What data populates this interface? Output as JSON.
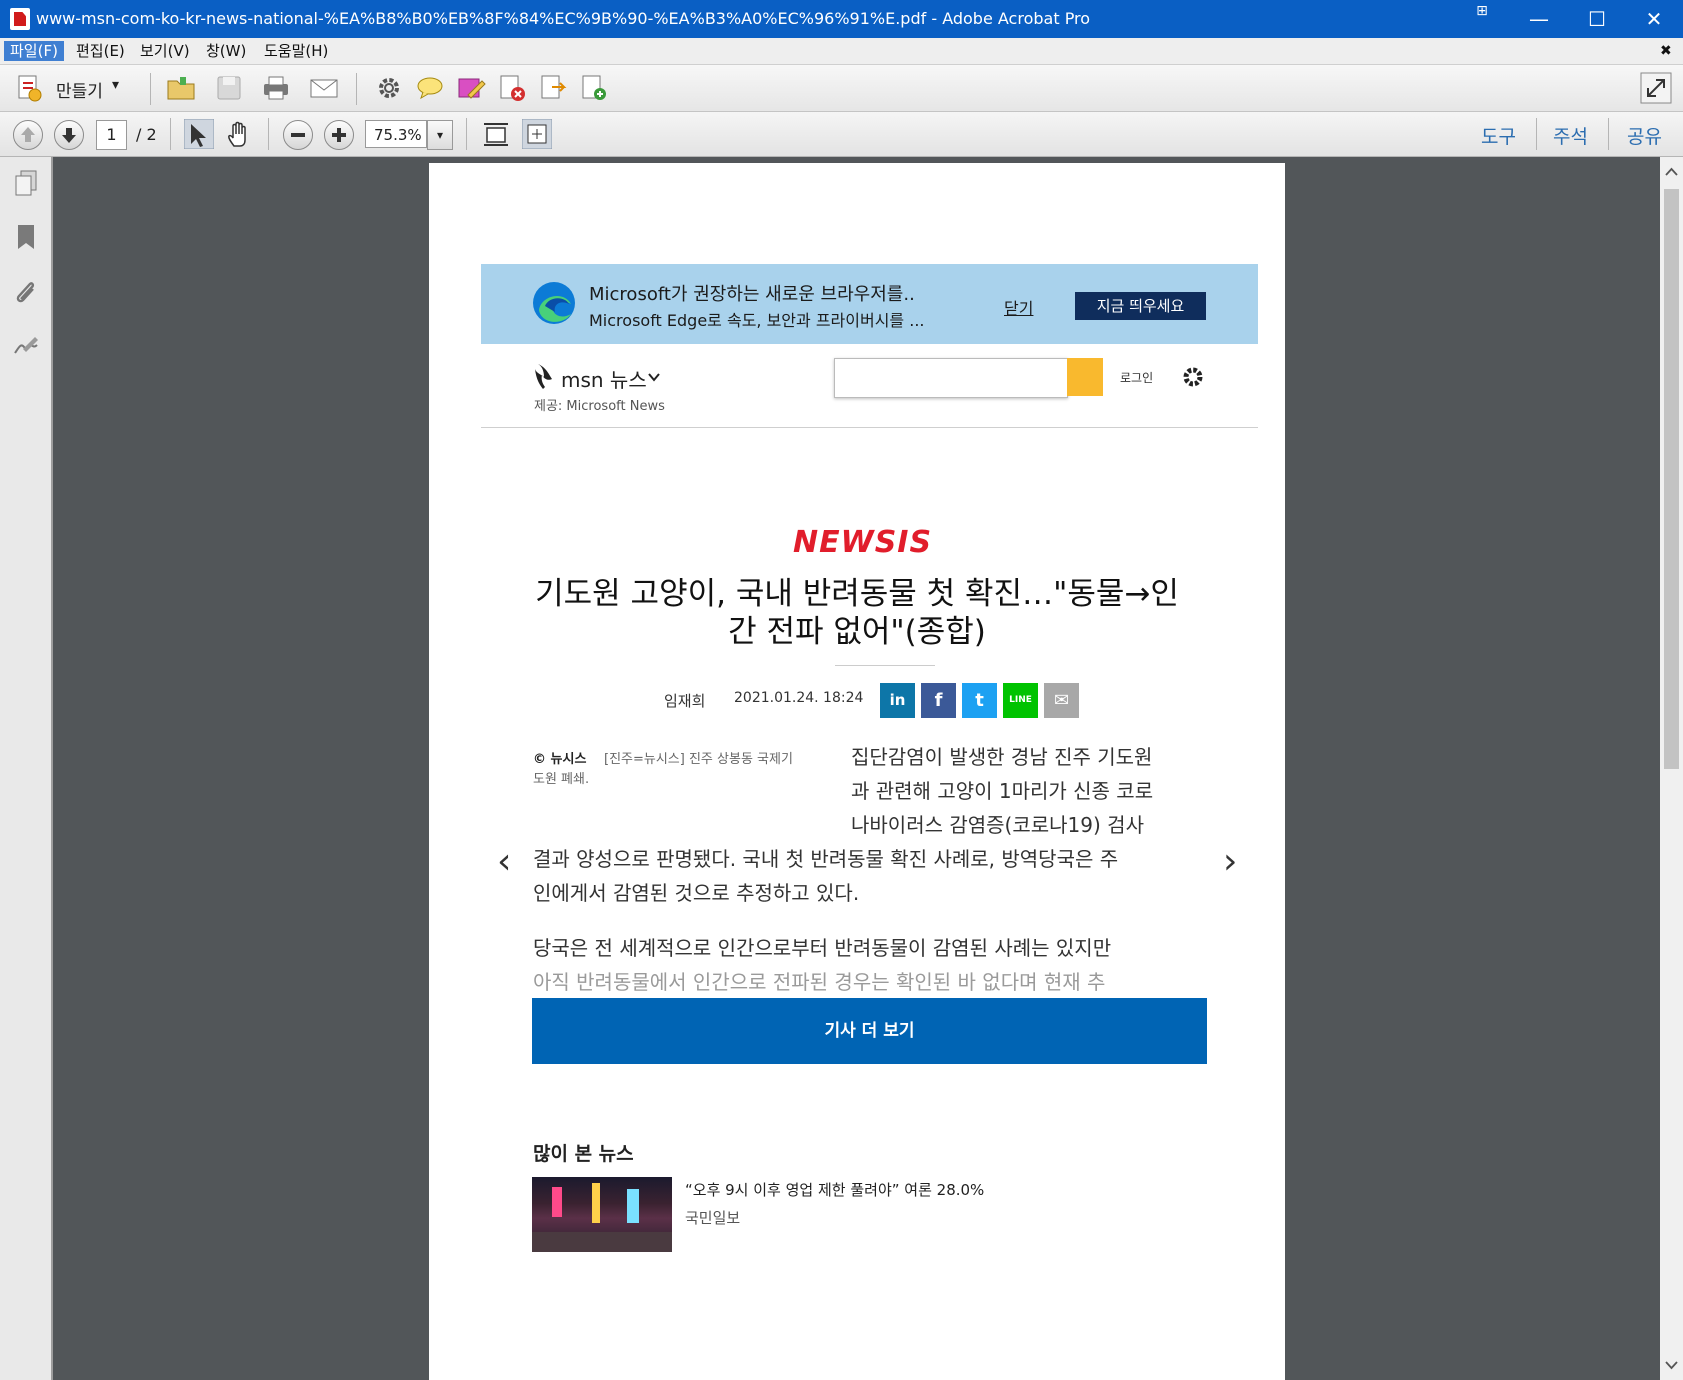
{
  "window": {
    "title": "www-msn-com-ko-kr-news-national-%EA%B8%B0%EB%8F%84%EC%9B%90-%EA%B3%A0%EC%96%91%E.pdf - Adobe Acrobat Pro",
    "minimize": "—",
    "maximize": "☐",
    "close": "✕",
    "snap": "⊞"
  },
  "menubar": {
    "items": [
      "파일(F)",
      "편집(E)",
      "보기(V)",
      "창(W)",
      "도움말(H)"
    ],
    "close_doc": "✖"
  },
  "toolbar1": {
    "create_label": "만들기",
    "create_caret": "▾"
  },
  "toolbar2": {
    "page_current": "1",
    "page_total": "/ 2",
    "zoom_value": "75.3%",
    "zoom_caret": "▾",
    "tools": "도구",
    "comment": "주석",
    "share": "공유"
  },
  "document": {
    "edge_banner": {
      "line1": "Microsoft가 권장하는 새로운 브라우저를..",
      "line2": "Microsoft Edge로 속도, 보안과 프라이버시를 ...",
      "close_link": "닫기",
      "launch_button": "지금 띄우세요"
    },
    "msn_header": {
      "brand": "msn 뉴스",
      "provider": "제공: Microsoft News",
      "login": "로그인"
    },
    "article": {
      "source_logo": "NEWSIS",
      "title_line1": "기도원 고양이, 국내 반려동물 첫 확진…\"동물→인",
      "title_line2": "간 전파 없어\"(종합)",
      "author": "임재희",
      "date": "2021.01.24. 18:24",
      "share_icons": [
        "linkedin-icon",
        "facebook-icon",
        "twitter-icon",
        "line-icon",
        "email-icon"
      ],
      "share_linkedin": "in",
      "share_facebook": "f",
      "share_twitter": "t",
      "share_line": "LINE",
      "share_email": "✉",
      "caption_source": "© 뉴시스",
      "caption_line1": "[진주=뉴시스] 진주 상봉동 국제기",
      "caption_line2": "도원 폐쇄.",
      "para1_lines": [
        "집단감염이 발생한 경남 진주 기도원",
        "과 관련해 고양이 1마리가 신종 코로",
        "나바이러스 감염증(코로나19) 검사",
        "결과 양성으로 판명됐다. 국내 첫 반려동물 확진 사례로, 방역당국은 주",
        "인에게서 감염된 것으로 추정하고 있다."
      ],
      "para2_lines": [
        "당국은 전 세계적으로 인간으로부터 반려동물이 감염된 사례는 있지만",
        "아직 반려동물에서 인간으로 전파된 경우는 확인된 바 없다며 현재 추"
      ],
      "more_button": "기사 더 보기",
      "prev_arrow": "‹",
      "next_arrow": "›"
    },
    "popular": {
      "heading": "많이 본 뉴스",
      "item_title": "“오후 9시 이후 영업 제한 풀려야” 여론 28.0%",
      "item_source": "국민일보"
    }
  },
  "colors": {
    "titlebar": "#0a5fc4",
    "edge_banner": "#a9d2ec",
    "more_button": "#0064b4",
    "newsis_red": "#e11d2b",
    "search_button": "#f9b92e"
  }
}
